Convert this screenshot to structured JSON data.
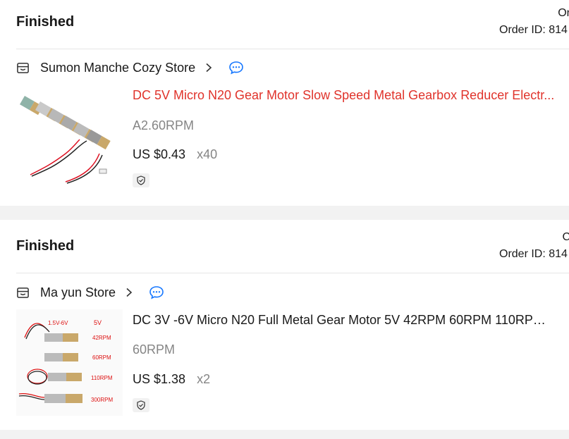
{
  "orders": [
    {
      "status": "Finished",
      "date_label": "Or",
      "order_id": "Order ID: 814",
      "store": "Sumon Manche Cozy Store",
      "product_title": "DC 5V Micro N20 Gear Motor Slow Speed Metal Gearbox Reducer Electr...",
      "variant": "A2.60RPM",
      "price": "US $0.43",
      "quantity": "x40",
      "title_color": "#e0332b"
    },
    {
      "status": "Finished",
      "date_label": "C",
      "order_id": "Order ID: 814",
      "store": "Ma yun Store",
      "product_title": "DC 3V -6V Micro N20 Full Metal Gear Motor 5V 42RPM 60RPM 110RPM ...",
      "variant": "60RPM",
      "price": "US $1.38",
      "quantity": "x2",
      "image_labels": [
        "1.5V-6V",
        "5V",
        "42RPM",
        "60RPM",
        "110RPM",
        "300RPM"
      ]
    }
  ],
  "icons": {
    "store": "store-icon",
    "chevron": "chevron-right-icon",
    "chat": "chat-icon",
    "shield": "shield-check-icon"
  },
  "colors": {
    "accent_red": "#e0332b",
    "chat_blue": "#1677ff",
    "muted": "#858585"
  }
}
